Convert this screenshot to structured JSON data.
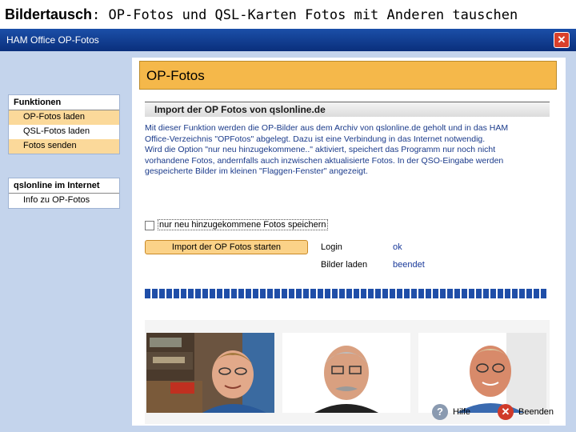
{
  "caption": {
    "bold": "Bildertausch",
    "rest": ": OP-Fotos und QSL-Karten Fotos mit Anderen tauschen"
  },
  "window": {
    "title": "HAM Office OP-Fotos",
    "close_glyph": "✕"
  },
  "sidebar": {
    "functions": {
      "header": "Funktionen",
      "items": [
        {
          "label": "OP-Fotos laden",
          "highlighted": true
        },
        {
          "label": "QSL-Fotos laden",
          "highlighted": false
        },
        {
          "label": "Fotos senden",
          "highlighted": true
        }
      ]
    },
    "internet": {
      "header": "qslonline im Internet",
      "items": [
        {
          "label": "Info zu OP-Fotos"
        }
      ]
    }
  },
  "main": {
    "title": "OP-Fotos",
    "section_title": "Import der OP Fotos von qslonline.de",
    "description_lines": [
      "Mit dieser Funktion werden die OP-Bilder aus dem Archiv von qslonline.de geholt und in das HAM",
      "Office-Verzeichnis \"OPFotos\" abgelegt. Dazu ist eine Verbindung in das Internet notwendig.",
      " Wird die Option \"nur neu hinzugekommene..\" aktiviert, speichert das Programm nur noch nicht",
      "vorhandene Fotos, andernfalls auch inzwischen aktualisierte Fotos. In der QSO-Eingabe werden",
      "gespeicherte Bilder im kleinen \"Flaggen-Fenster\" angezeigt."
    ],
    "checkbox": {
      "label": "nur neu hinzugekommene Fotos speichern",
      "checked": false
    },
    "start_button": "Import der OP Fotos starten",
    "status": [
      {
        "label": "Login",
        "value": "ok"
      },
      {
        "label": "Bilder laden",
        "value": "beendet"
      }
    ],
    "progress": 1.0
  },
  "footer": {
    "help_label": "Hilfe",
    "help_icon": "?",
    "exit_label": "Beenden",
    "exit_icon": "✕"
  },
  "colors": {
    "accent_orange": "#f5b84a",
    "highlight": "#fbd99a",
    "progress_blue": "#1f4ea8",
    "titlebar": "#0f3d92",
    "window_bg": "#c4d4ec"
  }
}
